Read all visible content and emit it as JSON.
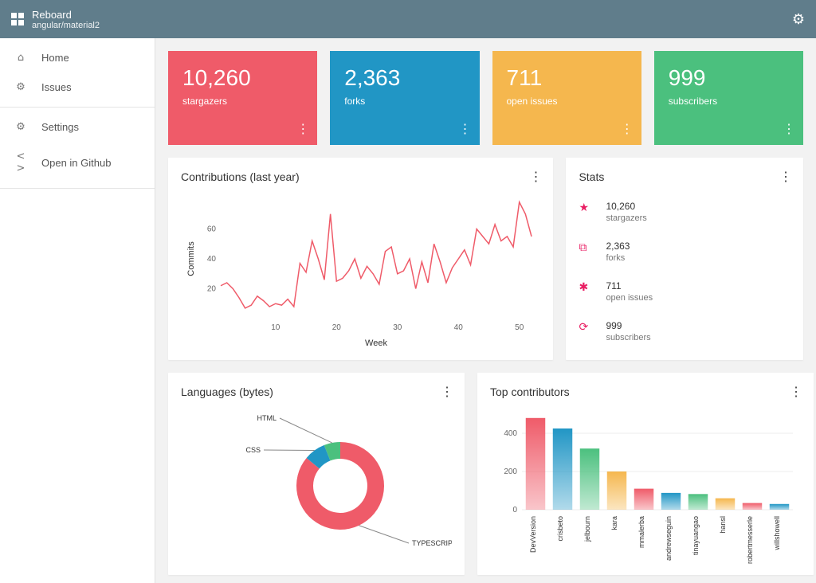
{
  "app": {
    "title": "Reboard",
    "subtitle": "angular/material2"
  },
  "sidebar": {
    "primary": [
      {
        "icon": "⌂",
        "label": "Home"
      },
      {
        "icon": "⚙",
        "label": "Issues"
      }
    ],
    "secondary": [
      {
        "icon": "⚙",
        "label": "Settings"
      },
      {
        "icon": "< >",
        "label": "Open in Github"
      }
    ]
  },
  "statcards": [
    {
      "value": "10,260",
      "label": "stargazers",
      "color": "c-red"
    },
    {
      "value": "2,363",
      "label": "forks",
      "color": "c-blue"
    },
    {
      "value": "711",
      "label": "open issues",
      "color": "c-yellow"
    },
    {
      "value": "999",
      "label": "subscribers",
      "color": "c-green"
    }
  ],
  "contributions": {
    "title": "Contributions (last year)"
  },
  "stats_panel": {
    "title": "Stats",
    "items": [
      {
        "icon": "★",
        "value": "10,260",
        "label": "stargazers"
      },
      {
        "icon": "⧉",
        "value": "2,363",
        "label": "forks"
      },
      {
        "icon": "✱",
        "value": "711",
        "label": "open issues"
      },
      {
        "icon": "⟳",
        "value": "999",
        "label": "subscribers"
      }
    ]
  },
  "languages": {
    "title": "Languages (bytes)"
  },
  "top_contributors": {
    "title": "Top contributors"
  },
  "chart_data": [
    {
      "id": "contributions",
      "type": "line",
      "title": "Contributions (last year)",
      "xlabel": "Week",
      "ylabel": "Commits",
      "x_ticks": [
        10,
        20,
        30,
        40,
        50
      ],
      "y_ticks": [
        20,
        40,
        60
      ],
      "x": [
        1,
        2,
        3,
        4,
        5,
        6,
        7,
        8,
        9,
        10,
        11,
        12,
        13,
        14,
        15,
        16,
        17,
        18,
        19,
        20,
        21,
        22,
        23,
        24,
        25,
        26,
        27,
        28,
        29,
        30,
        31,
        32,
        33,
        34,
        35,
        36,
        37,
        38,
        39,
        40,
        41,
        42,
        43,
        44,
        45,
        46,
        47,
        48,
        49,
        50,
        51,
        52
      ],
      "values": [
        22,
        24,
        20,
        14,
        7,
        9,
        15,
        12,
        8,
        10,
        9,
        13,
        8,
        37,
        31,
        52,
        40,
        26,
        70,
        25,
        27,
        32,
        40,
        27,
        35,
        30,
        23,
        45,
        48,
        30,
        32,
        40,
        20,
        38,
        24,
        50,
        38,
        24,
        34,
        40,
        46,
        36,
        60,
        55,
        50,
        63,
        52,
        55,
        48,
        78,
        70,
        55
      ],
      "color": "#ef5b69"
    },
    {
      "id": "languages",
      "type": "pie",
      "title": "Languages (bytes)",
      "series": [
        {
          "name": "TYPESCRIPT",
          "value": 86,
          "color": "#ef5b69"
        },
        {
          "name": "CSS",
          "value": 8,
          "color": "#2196c5"
        },
        {
          "name": "HTML",
          "value": 6,
          "color": "#4bc07e"
        }
      ],
      "donut": true
    },
    {
      "id": "top_contributors",
      "type": "bar",
      "ylabel": "",
      "y_ticks": [
        0,
        200,
        400
      ],
      "categories": [
        "DevVersion",
        "crisbeto",
        "jelbourn",
        "kara",
        "mmalerba",
        "andrewseguin",
        "tinayuangao",
        "hansl",
        "robertmesserle",
        "willshowell"
      ],
      "values": [
        480,
        425,
        320,
        200,
        110,
        88,
        82,
        60,
        35,
        30
      ],
      "colors": [
        "#ef5b69",
        "#2196c5",
        "#4bc07e",
        "#f5b74e",
        "#ef5b69",
        "#2196c5",
        "#4bc07e",
        "#f5b74e",
        "#ef5b69",
        "#2196c5"
      ]
    }
  ]
}
